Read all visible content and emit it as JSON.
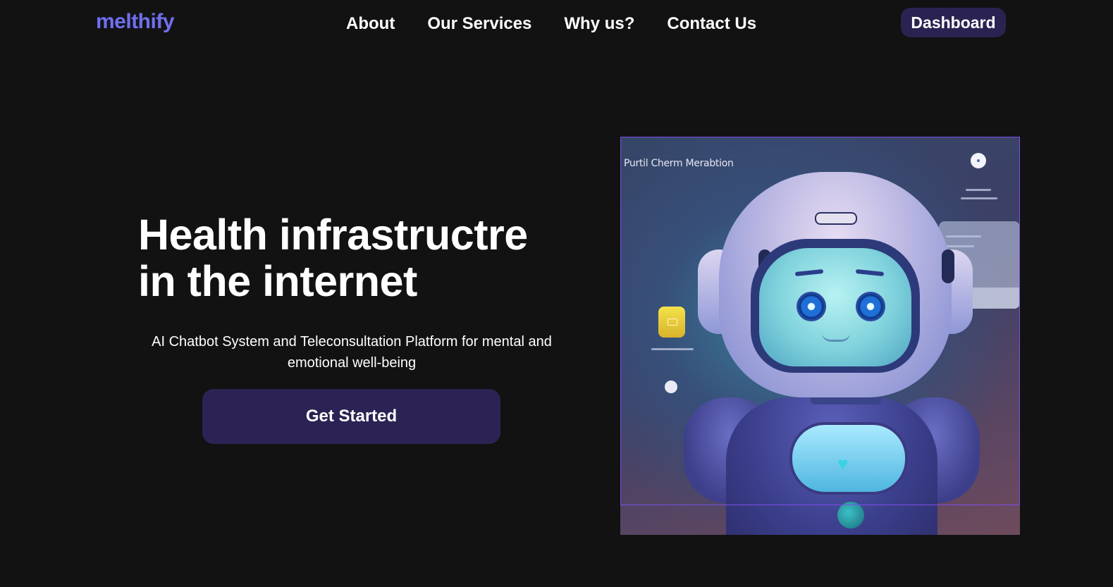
{
  "header": {
    "logo": "melthify",
    "nav": [
      "About",
      "Our Services",
      "Why us?",
      "Contact Us"
    ],
    "dashboard_label": "Dashboard"
  },
  "hero": {
    "title_line1": "Health infrastructre",
    "title_line2": "in the internet",
    "subtitle": "AI Chatbot System and Teleconsultation Platform for mental and emotional well-being",
    "cta_label": "Get Started",
    "image_caption": "Purtil Cherm Merabtion"
  },
  "colors": {
    "background": "#121212",
    "logo": "#6f6ff0",
    "button": "#2c2354",
    "image_border": "#7b4ee8"
  }
}
